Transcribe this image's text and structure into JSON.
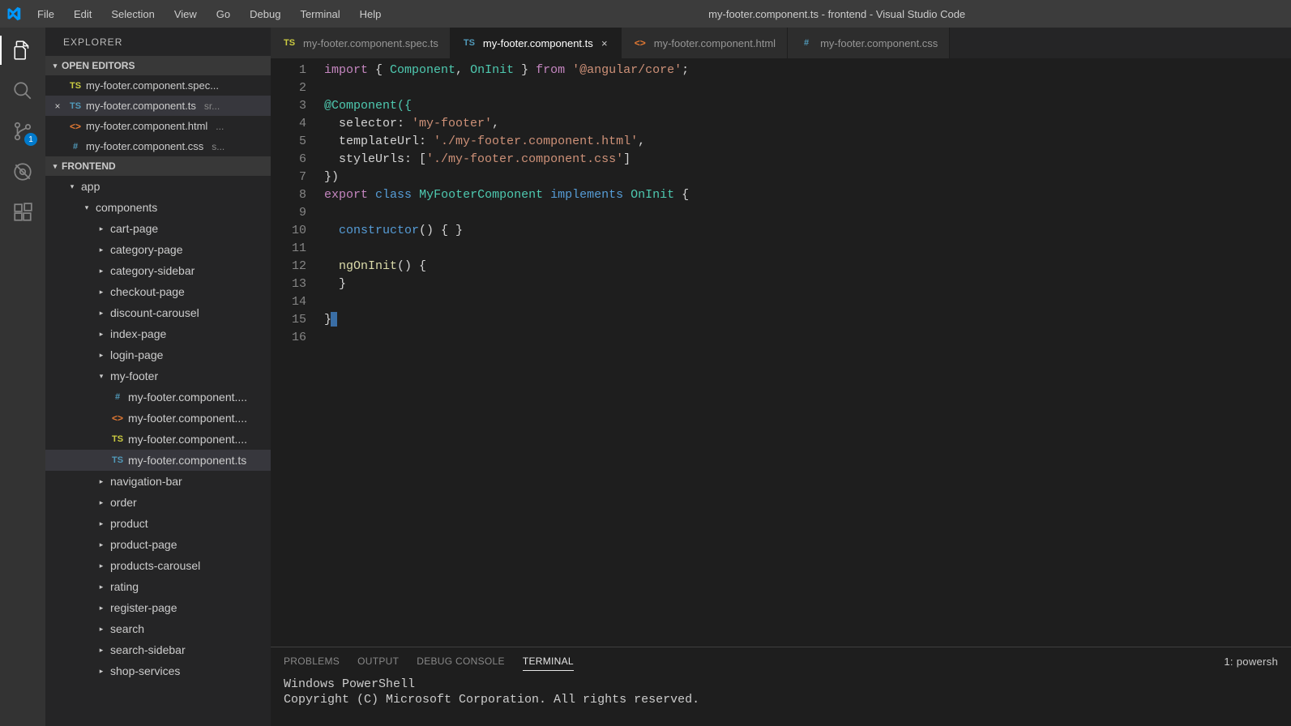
{
  "title": "my-footer.component.ts - frontend - Visual Studio Code",
  "menubar": [
    "File",
    "Edit",
    "Selection",
    "View",
    "Go",
    "Debug",
    "Terminal",
    "Help"
  ],
  "sidebar": {
    "title": "EXPLORER",
    "openEditorsLabel": "OPEN EDITORS",
    "projectLabel": "FRONTEND",
    "openEditors": [
      {
        "icon": "tsspec",
        "name": "my-footer.component.spec...",
        "suffix": ""
      },
      {
        "icon": "ts",
        "name": "my-footer.component.ts",
        "suffix": "sr...",
        "active": true
      },
      {
        "icon": "html",
        "name": "my-footer.component.html",
        "suffix": "..."
      },
      {
        "icon": "css",
        "name": "my-footer.component.css",
        "suffix": "s..."
      }
    ],
    "tree": [
      {
        "indent": 1,
        "twisty": "down",
        "name": "app"
      },
      {
        "indent": 2,
        "twisty": "down",
        "name": "components"
      },
      {
        "indent": 3,
        "twisty": "right",
        "name": "cart-page"
      },
      {
        "indent": 3,
        "twisty": "right",
        "name": "category-page"
      },
      {
        "indent": 3,
        "twisty": "right",
        "name": "category-sidebar"
      },
      {
        "indent": 3,
        "twisty": "right",
        "name": "checkout-page"
      },
      {
        "indent": 3,
        "twisty": "right",
        "name": "discount-carousel"
      },
      {
        "indent": 3,
        "twisty": "right",
        "name": "index-page"
      },
      {
        "indent": 3,
        "twisty": "right",
        "name": "login-page"
      },
      {
        "indent": 3,
        "twisty": "down",
        "name": "my-footer"
      },
      {
        "indent": 4,
        "fileicon": "css",
        "name": "my-footer.component...."
      },
      {
        "indent": 4,
        "fileicon": "html",
        "name": "my-footer.component...."
      },
      {
        "indent": 4,
        "fileicon": "tsspec",
        "name": "my-footer.component...."
      },
      {
        "indent": 4,
        "fileicon": "ts",
        "name": "my-footer.component.ts",
        "selected": true
      },
      {
        "indent": 3,
        "twisty": "right",
        "name": "navigation-bar"
      },
      {
        "indent": 3,
        "twisty": "right",
        "name": "order"
      },
      {
        "indent": 3,
        "twisty": "right",
        "name": "product"
      },
      {
        "indent": 3,
        "twisty": "right",
        "name": "product-page"
      },
      {
        "indent": 3,
        "twisty": "right",
        "name": "products-carousel"
      },
      {
        "indent": 3,
        "twisty": "right",
        "name": "rating"
      },
      {
        "indent": 3,
        "twisty": "right",
        "name": "register-page"
      },
      {
        "indent": 3,
        "twisty": "right",
        "name": "search"
      },
      {
        "indent": 3,
        "twisty": "right",
        "name": "search-sidebar"
      },
      {
        "indent": 3,
        "twisty": "right",
        "name": "shop-services"
      }
    ]
  },
  "scmBadge": "1",
  "tabs": [
    {
      "icon": "tsspec",
      "label": "my-footer.component.spec.ts"
    },
    {
      "icon": "ts",
      "label": "my-footer.component.ts",
      "active": true,
      "closeable": true
    },
    {
      "icon": "html",
      "label": "my-footer.component.html"
    },
    {
      "icon": "css",
      "label": "my-footer.component.css"
    }
  ],
  "code": {
    "lineCount": 16,
    "l1a": "import",
    "l1b": " { ",
    "l1c": "Component",
    "l1d": ", ",
    "l1e": "OnInit",
    "l1f": " } ",
    "l1g": "from",
    "l1h": " ",
    "l1i": "'@angular/core'",
    "l1j": ";",
    "l3": "@Component({",
    "l4a": "  selector",
    "l4b": ": ",
    "l4c": "'my-footer'",
    "l4d": ",",
    "l5a": "  templateUrl",
    "l5b": ": ",
    "l5c": "'./my-footer.component.html'",
    "l5d": ",",
    "l6a": "  styleUrls",
    "l6b": ": [",
    "l6c": "'./my-footer.component.css'",
    "l6d": "]",
    "l7": "})",
    "l8a": "export",
    "l8b": " ",
    "l8c": "class",
    "l8d": " ",
    "l8e": "MyFooterComponent",
    "l8f": " ",
    "l8g": "implements",
    "l8h": " ",
    "l8i": "OnInit",
    "l8j": " {",
    "l10a": "  ",
    "l10b": "constructor",
    "l10c": "() { }",
    "l12a": "  ",
    "l12b": "ngOnInit",
    "l12c": "() {",
    "l13": "  }",
    "l15": "}"
  },
  "panel": {
    "tabs": [
      "PROBLEMS",
      "OUTPUT",
      "DEBUG CONSOLE",
      "TERMINAL"
    ],
    "activeTab": 3,
    "rightLabel": "1: powersh",
    "terminalLines": [
      "Windows PowerShell",
      "Copyright (C) Microsoft Corporation. All rights reserved."
    ]
  }
}
